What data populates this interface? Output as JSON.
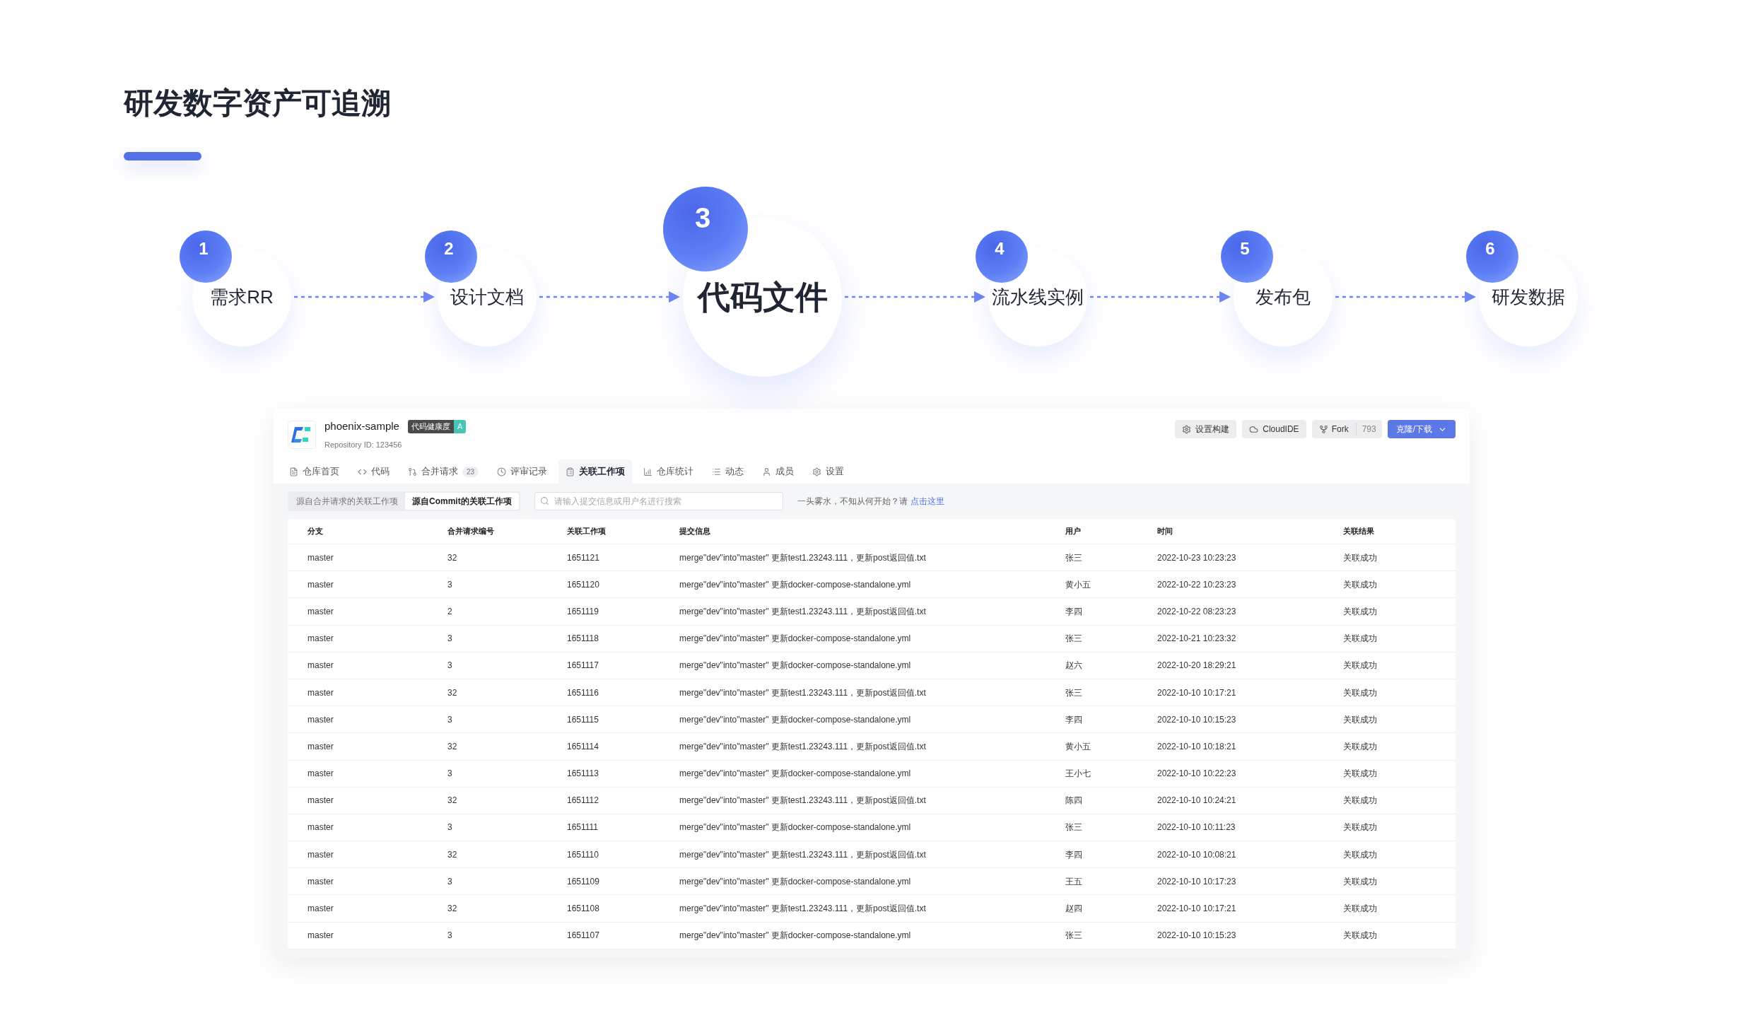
{
  "title": "研发数字资产可追溯",
  "steps": [
    {
      "number": "1",
      "label": "需求RR",
      "selected": false
    },
    {
      "number": "2",
      "label": "设计文档",
      "selected": false
    },
    {
      "number": "3",
      "label": "代码文件",
      "selected": true
    },
    {
      "number": "4",
      "label": "流水线实例",
      "selected": false
    },
    {
      "number": "5",
      "label": "发布包",
      "selected": false
    },
    {
      "number": "6",
      "label": "研发数据",
      "selected": false
    }
  ],
  "repo": {
    "name": "phoenix-sample",
    "health_label": "代码健康度",
    "health_grade": "A",
    "repo_id": "Repository ID: 123456",
    "buttons": [
      {
        "kind": "build",
        "label": "设置构建"
      },
      {
        "kind": "ide",
        "label": "CloudIDE"
      },
      {
        "kind": "fork",
        "label": "Fork",
        "count": "793"
      },
      {
        "kind": "clone",
        "label": "克隆/下载"
      }
    ]
  },
  "tabs": [
    {
      "label": "仓库首页",
      "selected": false
    },
    {
      "label": "代码",
      "selected": false
    },
    {
      "label": "合并请求",
      "count": "23",
      "selected": false
    },
    {
      "label": "评审记录",
      "selected": false
    },
    {
      "label": "关联工作项",
      "selected": true
    },
    {
      "label": "仓库统计",
      "selected": false
    },
    {
      "label": "动态",
      "selected": false
    },
    {
      "label": "成员",
      "selected": false
    },
    {
      "label": "设置",
      "selected": false
    }
  ],
  "source_filter": [
    {
      "label": "源自合并请求的关联工作项",
      "selected": false
    },
    {
      "label": "源自Commit的关联工作项",
      "selected": true
    }
  ],
  "search": {
    "placeholder": "请输入提交信息或用户名进行搜索"
  },
  "help": {
    "text": "一头雾水，不知从何开始？请",
    "link": "点击这里"
  },
  "table": {
    "columns": [
      "分支",
      "合并请求编号",
      "关联工作项",
      "提交信息",
      "用户",
      "时间",
      "关联结果"
    ],
    "rows": [
      [
        "master",
        "32",
        "1651121",
        "merge\"dev\"into\"master\" 更新test1.23243.111，更新post返回值.txt",
        "张三",
        "2022-10-23 10:23:23",
        "关联成功"
      ],
      [
        "master",
        "3",
        "1651120",
        "merge\"dev\"into\"master\" 更新docker-compose-standalone.yml",
        "黄小五",
        "2022-10-22 10:23:23",
        "关联成功"
      ],
      [
        "master",
        "2",
        "1651119",
        "merge\"dev\"into\"master\" 更新test1.23243.111，更新post返回值.txt",
        "李四",
        "2022-10-22 08:23:23",
        "关联成功"
      ],
      [
        "master",
        "3",
        "1651118",
        "merge\"dev\"into\"master\" 更新docker-compose-standalone.yml",
        "张三",
        "2022-10-21 10:23:32",
        "关联成功"
      ],
      [
        "master",
        "3",
        "1651117",
        "merge\"dev\"into\"master\" 更新docker-compose-standalone.yml",
        "赵六",
        "2022-10-20 18:29:21",
        "关联成功"
      ],
      [
        "master",
        "32",
        "1651116",
        "merge\"dev\"into\"master\" 更新test1.23243.111，更新post返回值.txt",
        "张三",
        "2022-10-10 10:17:21",
        "关联成功"
      ],
      [
        "master",
        "3",
        "1651115",
        "merge\"dev\"into\"master\" 更新docker-compose-standalone.yml",
        "李四",
        "2022-10-10 10:15:23",
        "关联成功"
      ],
      [
        "master",
        "32",
        "1651114",
        "merge\"dev\"into\"master\" 更新test1.23243.111，更新post返回值.txt",
        "黄小五",
        "2022-10-10 10:18:21",
        "关联成功"
      ],
      [
        "master",
        "3",
        "1651113",
        "merge\"dev\"into\"master\" 更新docker-compose-standalone.yml",
        "王小七",
        "2022-10-10 10:22:23",
        "关联成功"
      ],
      [
        "master",
        "32",
        "1651112",
        "merge\"dev\"into\"master\" 更新test1.23243.111，更新post返回值.txt",
        "陈四",
        "2022-10-10 10:24:21",
        "关联成功"
      ],
      [
        "master",
        "3",
        "1651111",
        "merge\"dev\"into\"master\" 更新docker-compose-standalone.yml",
        "张三",
        "2022-10-10 10:11:23",
        "关联成功"
      ],
      [
        "master",
        "32",
        "1651110",
        "merge\"dev\"into\"master\" 更新test1.23243.111，更新post返回值.txt",
        "李四",
        "2022-10-10 10:08:21",
        "关联成功"
      ],
      [
        "master",
        "3",
        "1651109",
        "merge\"dev\"into\"master\" 更新docker-compose-standalone.yml",
        "王五",
        "2022-10-10 10:17:23",
        "关联成功"
      ],
      [
        "master",
        "32",
        "1651108",
        "merge\"dev\"into\"master\" 更新test1.23243.111，更新post返回值.txt",
        "赵四",
        "2022-10-10 10:17:21",
        "关联成功"
      ],
      [
        "master",
        "3",
        "1651107",
        "merge\"dev\"into\"master\" 更新docker-compose-standalone.yml",
        "张三",
        "2022-10-10 10:15:23",
        "关联成功"
      ]
    ]
  }
}
